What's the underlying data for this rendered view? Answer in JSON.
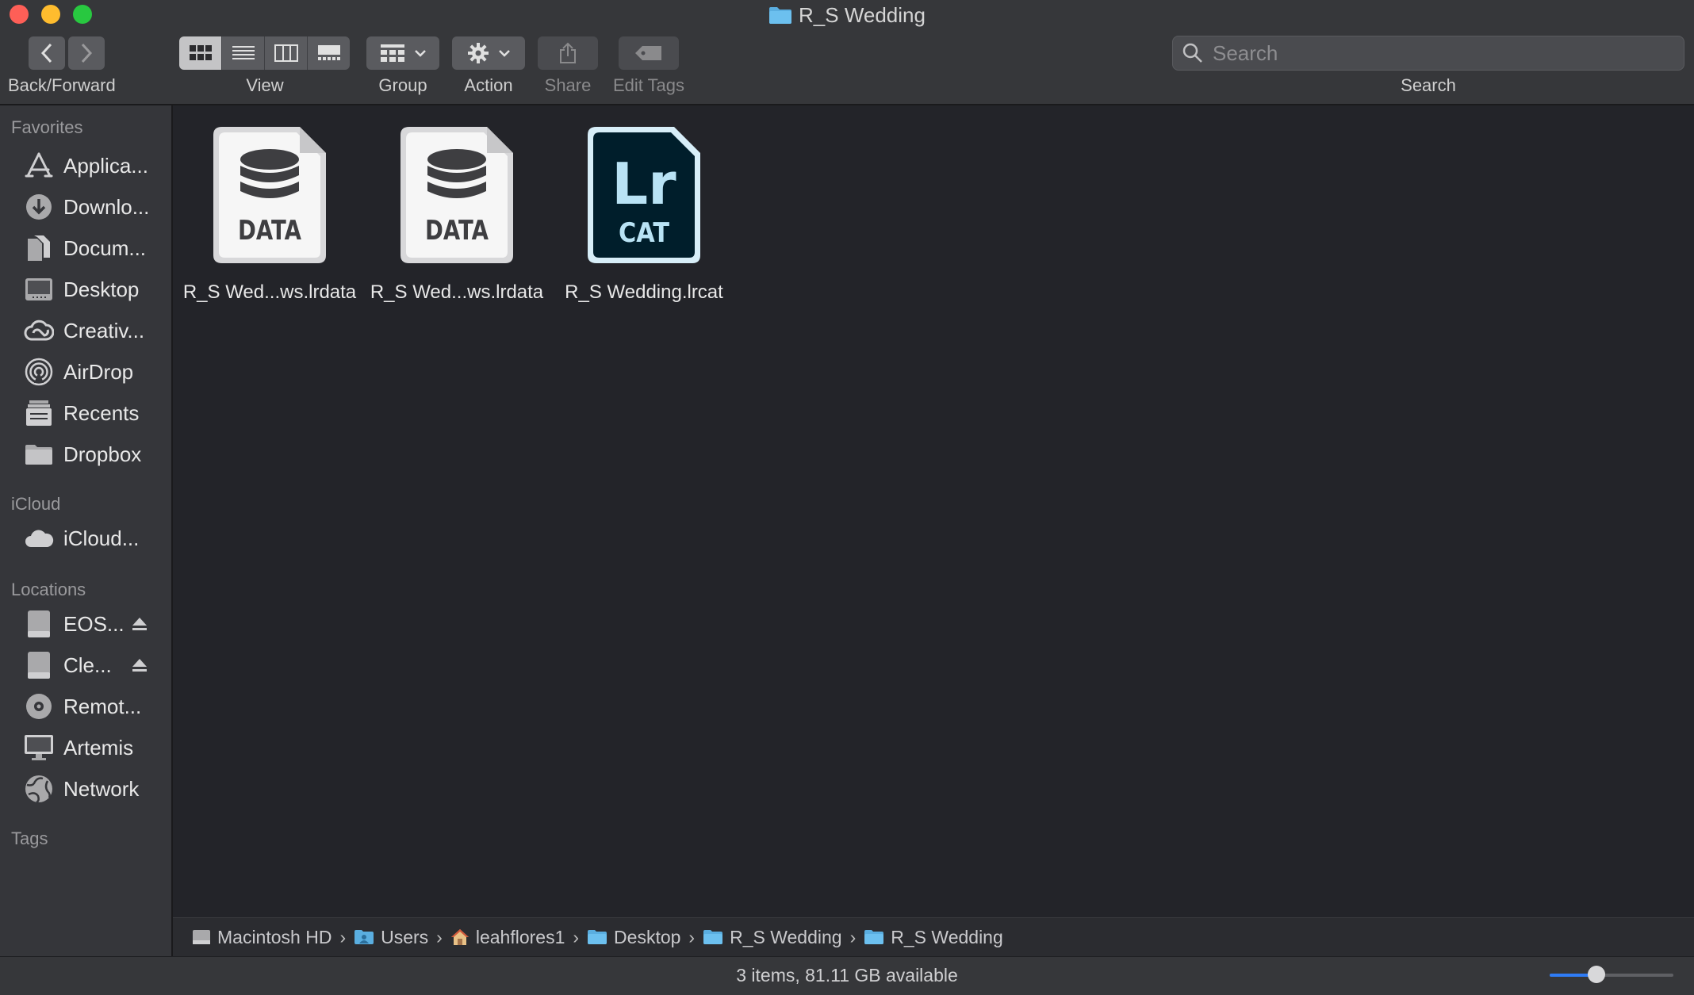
{
  "window": {
    "title": "R_S Wedding"
  },
  "toolbar": {
    "back_forward_label": "Back/Forward",
    "view_label": "View",
    "group_label": "Group",
    "action_label": "Action",
    "share_label": "Share",
    "edit_tags_label": "Edit Tags",
    "search_label": "Search",
    "search_placeholder": "Search"
  },
  "sidebar": {
    "favorites_header": "Favorites",
    "favorites": [
      {
        "label": "Applica...",
        "icon": "applications-icon"
      },
      {
        "label": "Downlo...",
        "icon": "downloads-icon"
      },
      {
        "label": "Docum...",
        "icon": "documents-icon"
      },
      {
        "label": "Desktop",
        "icon": "desktop-icon"
      },
      {
        "label": "Creativ...",
        "icon": "creative-cloud-icon"
      },
      {
        "label": "AirDrop",
        "icon": "airdrop-icon"
      },
      {
        "label": "Recents",
        "icon": "recents-icon"
      },
      {
        "label": "Dropbox",
        "icon": "folder-icon"
      }
    ],
    "icloud_header": "iCloud",
    "icloud": [
      {
        "label": "iCloud...",
        "icon": "cloud-icon"
      }
    ],
    "locations_header": "Locations",
    "locations": [
      {
        "label": "EOS...",
        "icon": "drive-icon",
        "ejectable": true
      },
      {
        "label": "Cle...",
        "icon": "drive-icon",
        "ejectable": true
      },
      {
        "label": "Remot...",
        "icon": "disc-icon"
      },
      {
        "label": "Artemis",
        "icon": "computer-icon"
      },
      {
        "label": "Network",
        "icon": "network-globe-icon"
      }
    ],
    "tags_header": "Tags"
  },
  "files": [
    {
      "name": "R_S Wed...ws.lrdata",
      "badge": "DATA",
      "kind": "data"
    },
    {
      "name": "R_S Wed...ws.lrdata",
      "badge": "DATA",
      "kind": "data"
    },
    {
      "name": "R_S Wedding.lrcat",
      "badge": "CAT",
      "logo": "Lr",
      "kind": "lrcat"
    }
  ],
  "pathbar": {
    "items": [
      "Macintosh HD",
      "Users",
      "leahflores1",
      "Desktop",
      "R_S Wedding",
      "R_S Wedding"
    ]
  },
  "status": {
    "text": "3 items, 81.11 GB available",
    "zoom_level": 0.38
  },
  "colors": {
    "accent": "#2f7cf6",
    "folder": "#5aaee0",
    "lrcat_bg": "#001e2b",
    "lrcat_text": "#b9e3f5"
  }
}
